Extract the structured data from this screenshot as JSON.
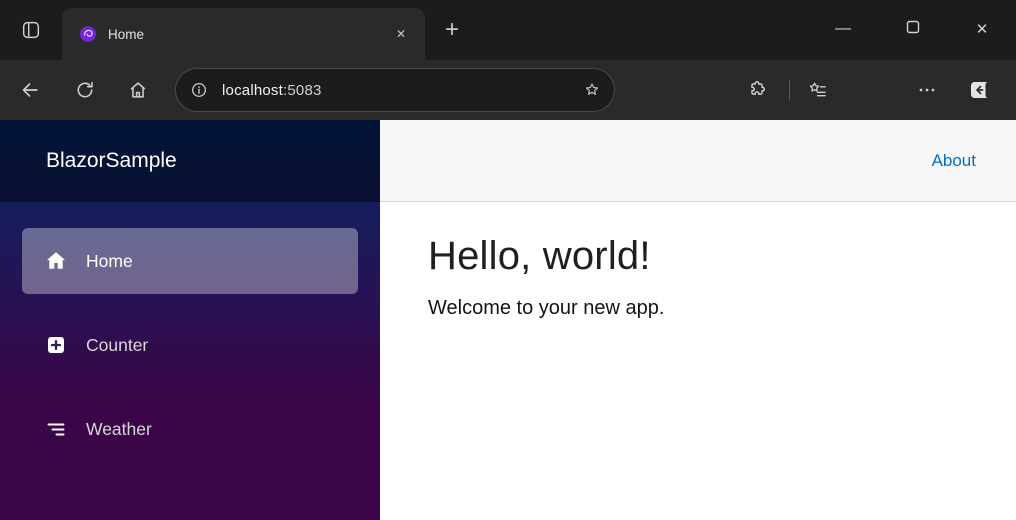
{
  "colors": {
    "titlebar_bg": "#1c1c1c",
    "toolbar_bg": "#2a2a2a",
    "addressbar_bg": "#1c1c1c",
    "sidebar_gradient_top": "#052767",
    "sidebar_gradient_bottom": "#3a0647",
    "nav_active_bg": "rgba(255,255,255,0.35)",
    "about_link_blue": "#0071c1",
    "favicon_purple": "#7526d9"
  },
  "browser": {
    "tab": {
      "title": "Home"
    },
    "glyphs": {
      "tab_close": "✕",
      "new_tab": "+",
      "minimize": "—",
      "window_close": "✕"
    },
    "address": {
      "host": "localhost",
      "port": ":5083"
    }
  },
  "app": {
    "brand": "BlazorSample",
    "nav": [
      {
        "label": "Home",
        "active": true
      },
      {
        "label": "Counter",
        "active": false
      },
      {
        "label": "Weather",
        "active": false
      }
    ],
    "header": {
      "about": "About"
    },
    "main": {
      "title": "Hello, world!",
      "subtitle": "Welcome to your new app."
    }
  }
}
